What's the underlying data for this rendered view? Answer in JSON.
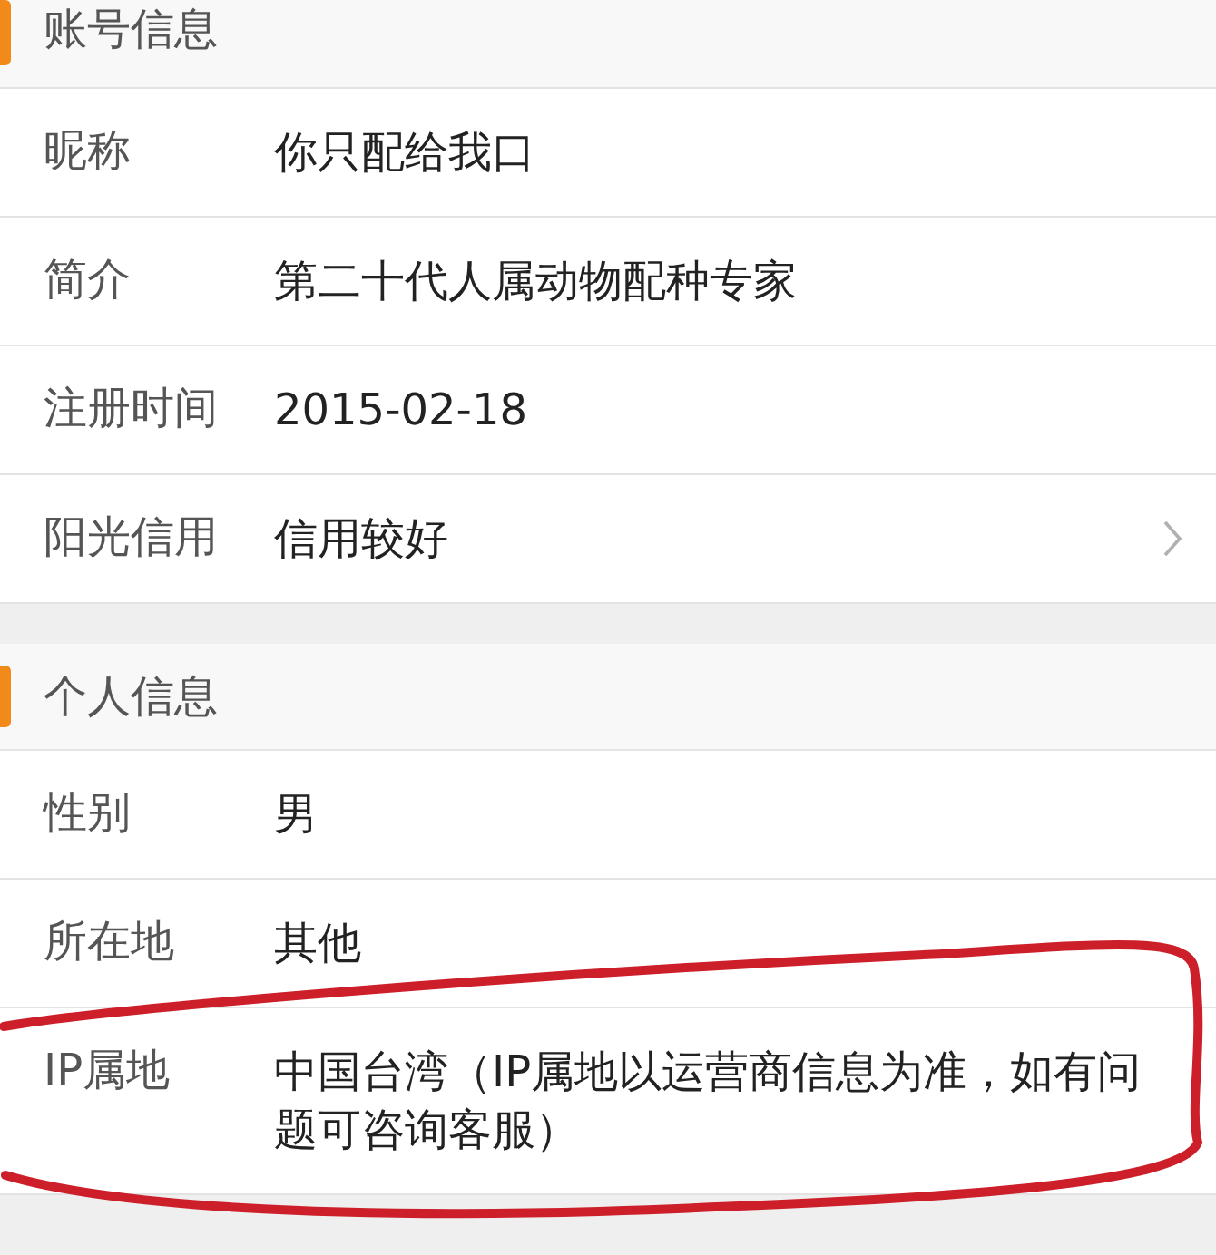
{
  "sections": [
    {
      "title": "账号信息",
      "rows": [
        {
          "kind": "plain",
          "label": "昵称",
          "value": "你只配给我口"
        },
        {
          "kind": "plain",
          "label": "简介",
          "value": "第二十代人属动物配种专家"
        },
        {
          "kind": "plain",
          "label": "注册时间",
          "value": "2015-02-18"
        },
        {
          "kind": "link",
          "label": "阳光信用",
          "value": "信用较好"
        }
      ]
    },
    {
      "title": "个人信息",
      "rows": [
        {
          "kind": "plain",
          "label": "性别",
          "value": "男"
        },
        {
          "kind": "plain",
          "label": "所在地",
          "value": "其他"
        },
        {
          "kind": "plain",
          "label": "IP属地",
          "value": "中国台湾（IP属地以运营商信息为准，如有问题可咨询客服）"
        }
      ]
    }
  ]
}
